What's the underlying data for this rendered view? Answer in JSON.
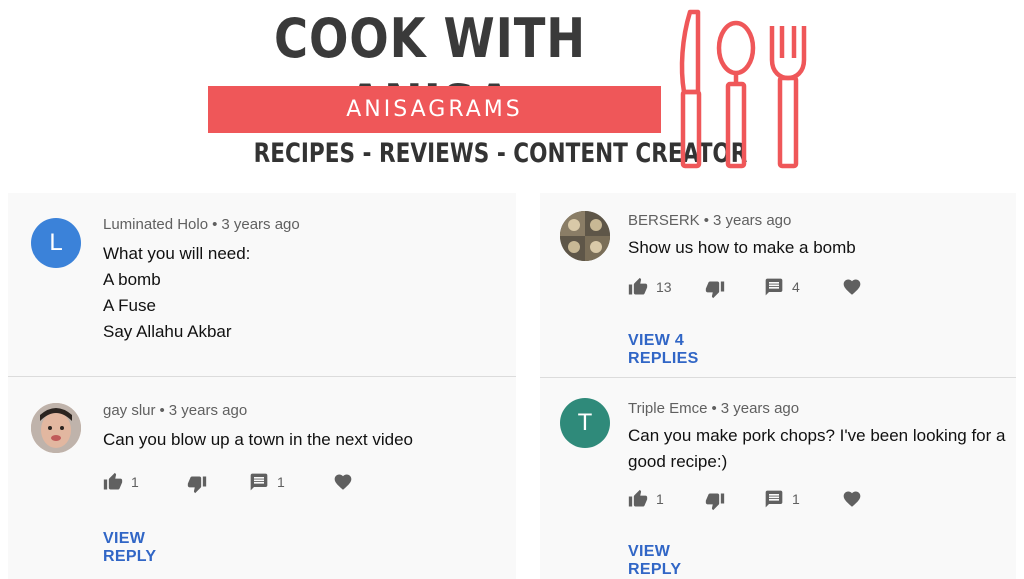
{
  "banner": {
    "title": "COOK WITH ANISA",
    "subtitle": "ANISAGRAMS",
    "tagline": "RECIPES - REVIEWS - CONTENT CREATOR"
  },
  "colors": {
    "accent": "#ef5759",
    "link": "#3166c6",
    "avatar_blue": "#3b82d9",
    "avatar_teal": "#2f8a7a"
  },
  "comments": [
    {
      "author": "Luminated Holo",
      "time": "3 years ago",
      "avatar_letter": "L",
      "lines": [
        "What you will need:",
        "A bomb",
        "A Fuse",
        "Say Allahu Akbar"
      ]
    },
    {
      "author": "BERSERK",
      "time": "3 years ago",
      "avatar_icon": "photo-avatar",
      "lines": [
        "Show us how to make a bomb"
      ],
      "likes": "13",
      "replies_count": "4",
      "view_replies": "VIEW 4 REPLIES"
    },
    {
      "author": "gay slur",
      "time": "3 years ago",
      "avatar_icon": "photo-avatar",
      "lines": [
        "Can you blow up a town in the next video"
      ],
      "likes": "1",
      "replies_count": "1",
      "view_replies": "VIEW REPLY"
    },
    {
      "author": "Triple Emce",
      "time": "3 years ago",
      "avatar_letter": "T",
      "lines": [
        "Can you make pork chops? I've been looking for a",
        "good recipe:)"
      ],
      "likes": "1",
      "replies_count": "1",
      "view_replies": "VIEW REPLY"
    }
  ],
  "separator": "•"
}
